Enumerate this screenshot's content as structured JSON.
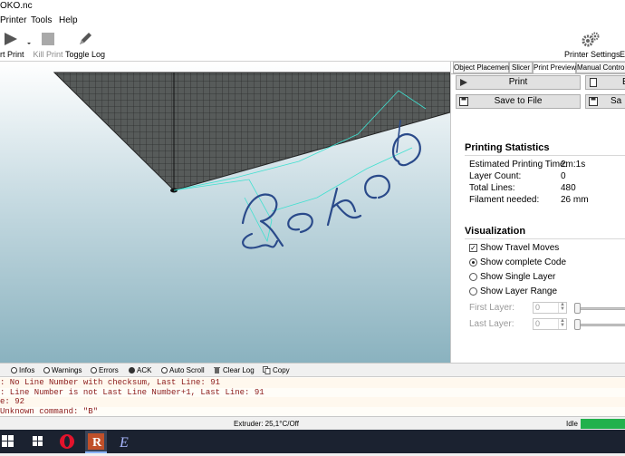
{
  "window": {
    "title": "OKO.nc"
  },
  "menu": {
    "items": [
      "Printer",
      "Tools",
      "Help"
    ]
  },
  "toolbar": {
    "start_print": "rt Print",
    "kill_print": "Kill Print",
    "toggle_log": "Toggle Log",
    "printer_settings": "Printer Settings",
    "cut_right": "E"
  },
  "tabs": {
    "object_placement": "Object Placement",
    "slicer": "Slicer",
    "print_preview": "Print Preview",
    "manual_control": "Manual Control"
  },
  "panel": {
    "print_button": "Print",
    "print_right_cut": "E",
    "save_button": "Save to File",
    "save_right_cut": "Sa",
    "stats_title": "Printing Statistics",
    "stats": [
      {
        "label": "Estimated Printing Time:",
        "value": "2m:1s"
      },
      {
        "label": "Layer Count:",
        "value": "0"
      },
      {
        "label": "Total Lines:",
        "value": "480"
      },
      {
        "label": "Filament needed:",
        "value": "26 mm"
      }
    ],
    "vis_title": "Visualization",
    "show_travel": "Show Travel Moves",
    "show_complete": "Show complete Code",
    "show_single": "Show Single Layer",
    "show_range": "Show Layer Range",
    "first_layer": "First Layer:",
    "last_layer": "Last Layer:",
    "first_layer_value": "0",
    "last_layer_value": "0"
  },
  "logbar": {
    "infos": "Infos",
    "warnings": "Warnings",
    "errors": "Errors",
    "ack": "ACK",
    "autoscroll": "Auto Scroll",
    "clear": "Clear Log",
    "copy": "Copy"
  },
  "log": [
    {
      "text": ": No Line Number with checksum, Last Line: 91",
      "color": "#8b1a1a"
    },
    {
      "text": ": Line Number is not Last Line Number+1, Last Line: 91",
      "color": "#8b1a1a"
    },
    {
      "text": "e: 92",
      "color": "#8b1a1a"
    },
    {
      "text": "Unknown command: \"B\"",
      "color": "#8b1a1a"
    }
  ],
  "status": {
    "extruder": "Extruder: 25,1°C/Off",
    "state": "Idle"
  },
  "colors": {
    "accent_green": "#22b14c",
    "travel": "#40e0d0",
    "toolpath": "#2a4a8a"
  }
}
